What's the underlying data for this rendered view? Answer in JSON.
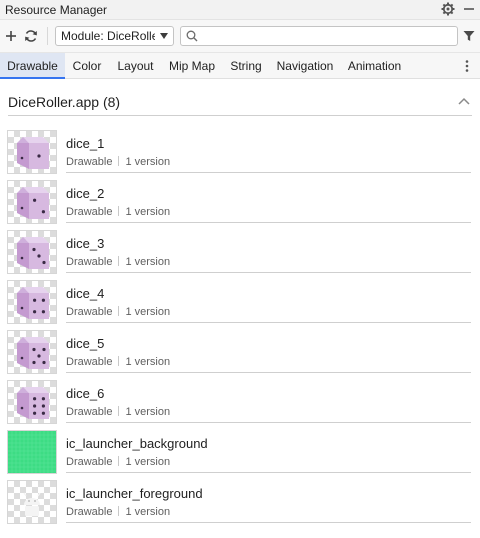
{
  "window": {
    "title": "Resource Manager"
  },
  "toolbar": {
    "module_label": "Module: DiceRoller",
    "search_placeholder": ""
  },
  "tabs": [
    {
      "label": "Drawable",
      "active": true
    },
    {
      "label": "Color"
    },
    {
      "label": "Layout"
    },
    {
      "label": "Mip Map"
    },
    {
      "label": "String"
    },
    {
      "label": "Navigation"
    },
    {
      "label": "Animation"
    }
  ],
  "group": {
    "label": "DiceRoller.app (8)"
  },
  "resources": [
    {
      "name": "dice_1",
      "type": "Drawable",
      "versions": "1 version",
      "thumb": "dice-1"
    },
    {
      "name": "dice_2",
      "type": "Drawable",
      "versions": "1 version",
      "thumb": "dice-2"
    },
    {
      "name": "dice_3",
      "type": "Drawable",
      "versions": "1 version",
      "thumb": "dice-3"
    },
    {
      "name": "dice_4",
      "type": "Drawable",
      "versions": "1 version",
      "thumb": "dice-4"
    },
    {
      "name": "dice_5",
      "type": "Drawable",
      "versions": "1 version",
      "thumb": "dice-5"
    },
    {
      "name": "dice_6",
      "type": "Drawable",
      "versions": "1 version",
      "thumb": "dice-6"
    },
    {
      "name": "ic_launcher_background",
      "type": "Drawable",
      "versions": "1 version",
      "thumb": "green-grid"
    },
    {
      "name": "ic_launcher_foreground",
      "type": "Drawable",
      "versions": "1 version",
      "thumb": "android-robot"
    }
  ],
  "colors": {
    "accent": "#3574f0",
    "active_tab_bg": "#dfe6f3",
    "dice_face": "#d7b9e0",
    "dice_side": "#c49ad0",
    "dice_pip": "#3a2a45",
    "launcher_green": "#3ddc84"
  }
}
